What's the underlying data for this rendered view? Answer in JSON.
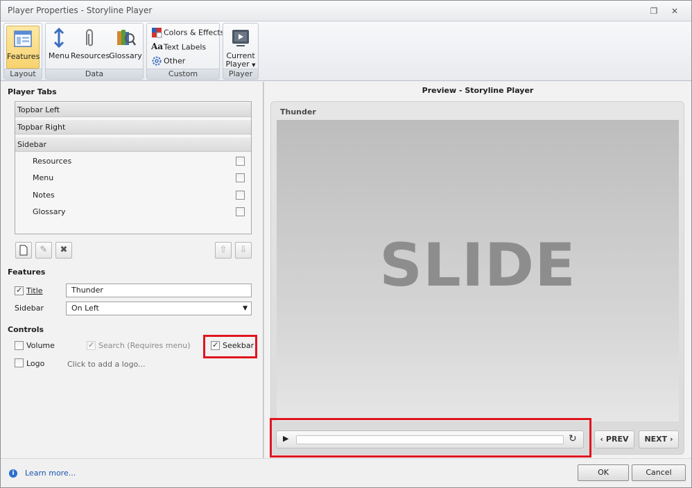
{
  "window": {
    "title": "Player Properties - Storyline Player"
  },
  "ribbon": {
    "groups": [
      {
        "label": "Layout",
        "buttons": [
          {
            "label": "Features"
          }
        ]
      },
      {
        "label": "Data",
        "buttons": [
          {
            "label": "Menu"
          },
          {
            "label": "Resources"
          },
          {
            "label": "Glossary"
          }
        ]
      },
      {
        "label": "Custom",
        "items": [
          {
            "label": "Colors & Effects"
          },
          {
            "label": "Text Labels"
          },
          {
            "label": "Other"
          }
        ]
      },
      {
        "label": "Player",
        "buttons": [
          {
            "label_line1": "Current",
            "label_line2": "Player"
          }
        ]
      }
    ]
  },
  "left": {
    "player_tabs_title": "Player Tabs",
    "tabs": [
      {
        "label": "Topbar Left"
      },
      {
        "label": "Topbar Right"
      },
      {
        "label": "Sidebar"
      }
    ],
    "sidebar_items": [
      {
        "label": "Resources",
        "checked": false
      },
      {
        "label": "Menu",
        "checked": false
      },
      {
        "label": "Notes",
        "checked": false
      },
      {
        "label": "Glossary",
        "checked": false
      }
    ],
    "features_title": "Features",
    "title_checkbox_label": "Title",
    "title_value": "Thunder",
    "sidebar_label": "Sidebar",
    "sidebar_value": "On Left",
    "controls_title": "Controls",
    "volume_label": "Volume",
    "search_label": "Search (Requires menu)",
    "seekbar_label": "Seekbar",
    "logo_label": "Logo",
    "logo_hint": "Click to add a logo..."
  },
  "preview": {
    "title": "Preview - Storyline Player",
    "player_title": "Thunder",
    "slide_text": "SLIDE",
    "prev_label": "PREV",
    "next_label": "NEXT"
  },
  "footer": {
    "learn_more": "Learn more...",
    "ok_label": "OK",
    "cancel_label": "Cancel"
  },
  "colors": {
    "highlight": "#e0151f",
    "active_button": "#f7d36e",
    "link": "#1a55b0"
  }
}
